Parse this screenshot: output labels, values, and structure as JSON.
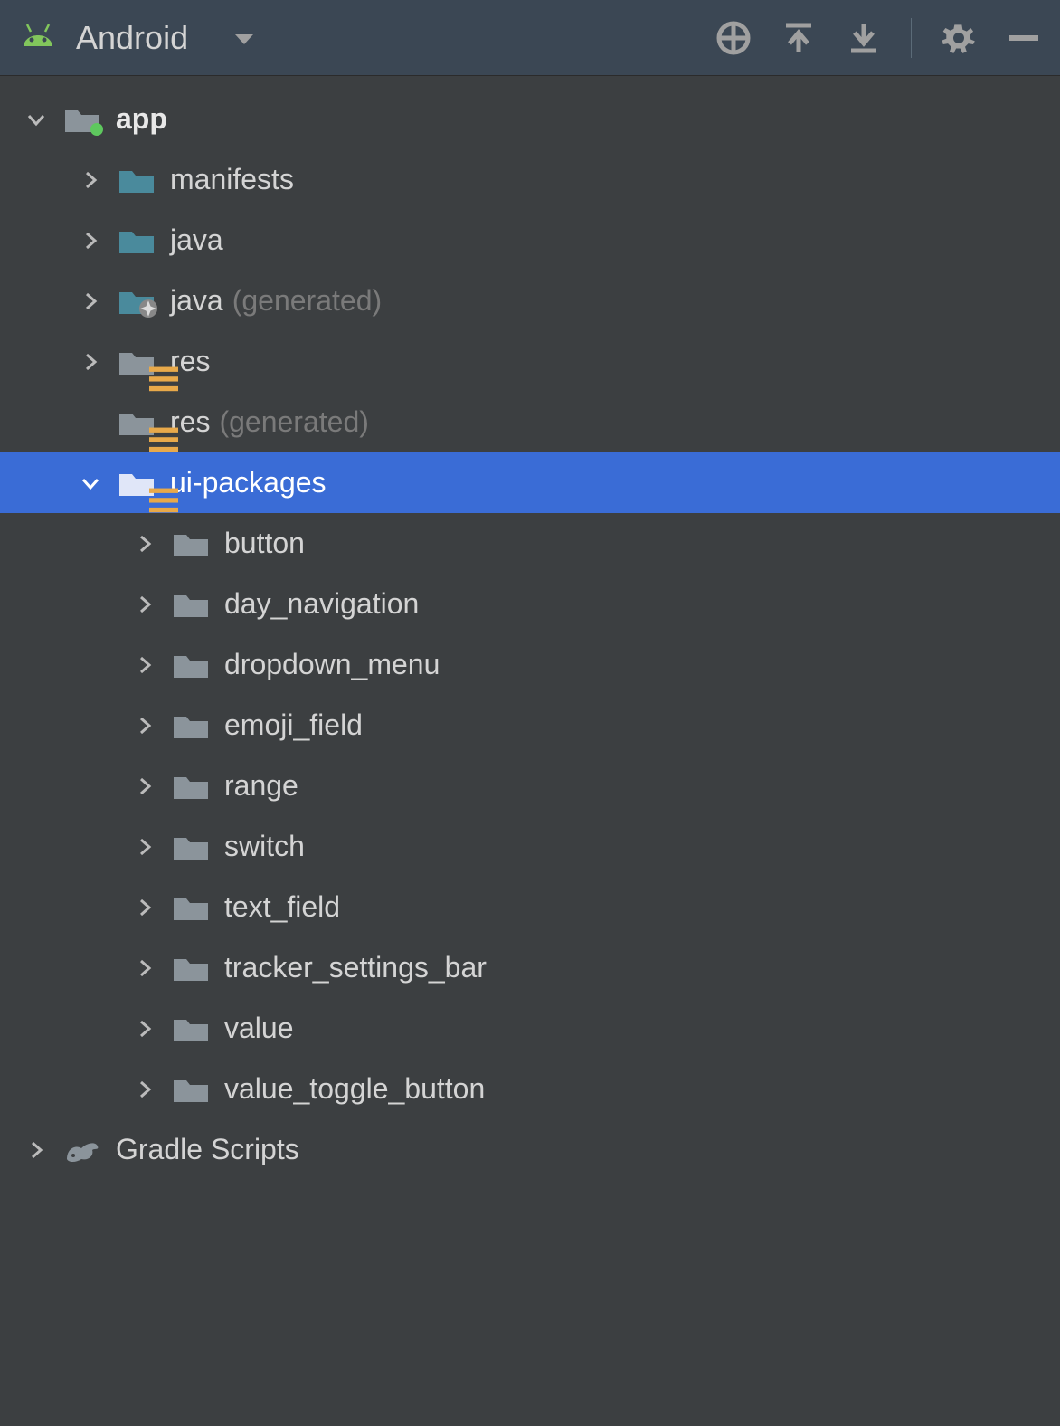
{
  "header": {
    "title": "Android"
  },
  "tree": {
    "root": {
      "label": "app"
    },
    "children": [
      {
        "label": "manifests",
        "suffix": "",
        "icon": "folder-teal",
        "chevron": "right"
      },
      {
        "label": "java",
        "suffix": "",
        "icon": "folder-teal",
        "chevron": "right"
      },
      {
        "label": "java",
        "suffix": "(generated)",
        "icon": "folder-teal-gen",
        "chevron": "right"
      },
      {
        "label": "res",
        "suffix": "",
        "icon": "folder-res",
        "chevron": "right"
      },
      {
        "label": "res",
        "suffix": "(generated)",
        "icon": "folder-res",
        "chevron": "none"
      },
      {
        "label": "ui-packages",
        "suffix": "",
        "icon": "folder-res",
        "chevron": "down",
        "selected": true
      }
    ],
    "ui_packages": [
      {
        "label": "button"
      },
      {
        "label": "day_navigation"
      },
      {
        "label": "dropdown_menu"
      },
      {
        "label": "emoji_field"
      },
      {
        "label": "range"
      },
      {
        "label": "switch"
      },
      {
        "label": "text_field"
      },
      {
        "label": "tracker_settings_bar"
      },
      {
        "label": "value"
      },
      {
        "label": "value_toggle_button"
      }
    ],
    "gradle": {
      "label": "Gradle Scripts"
    }
  }
}
